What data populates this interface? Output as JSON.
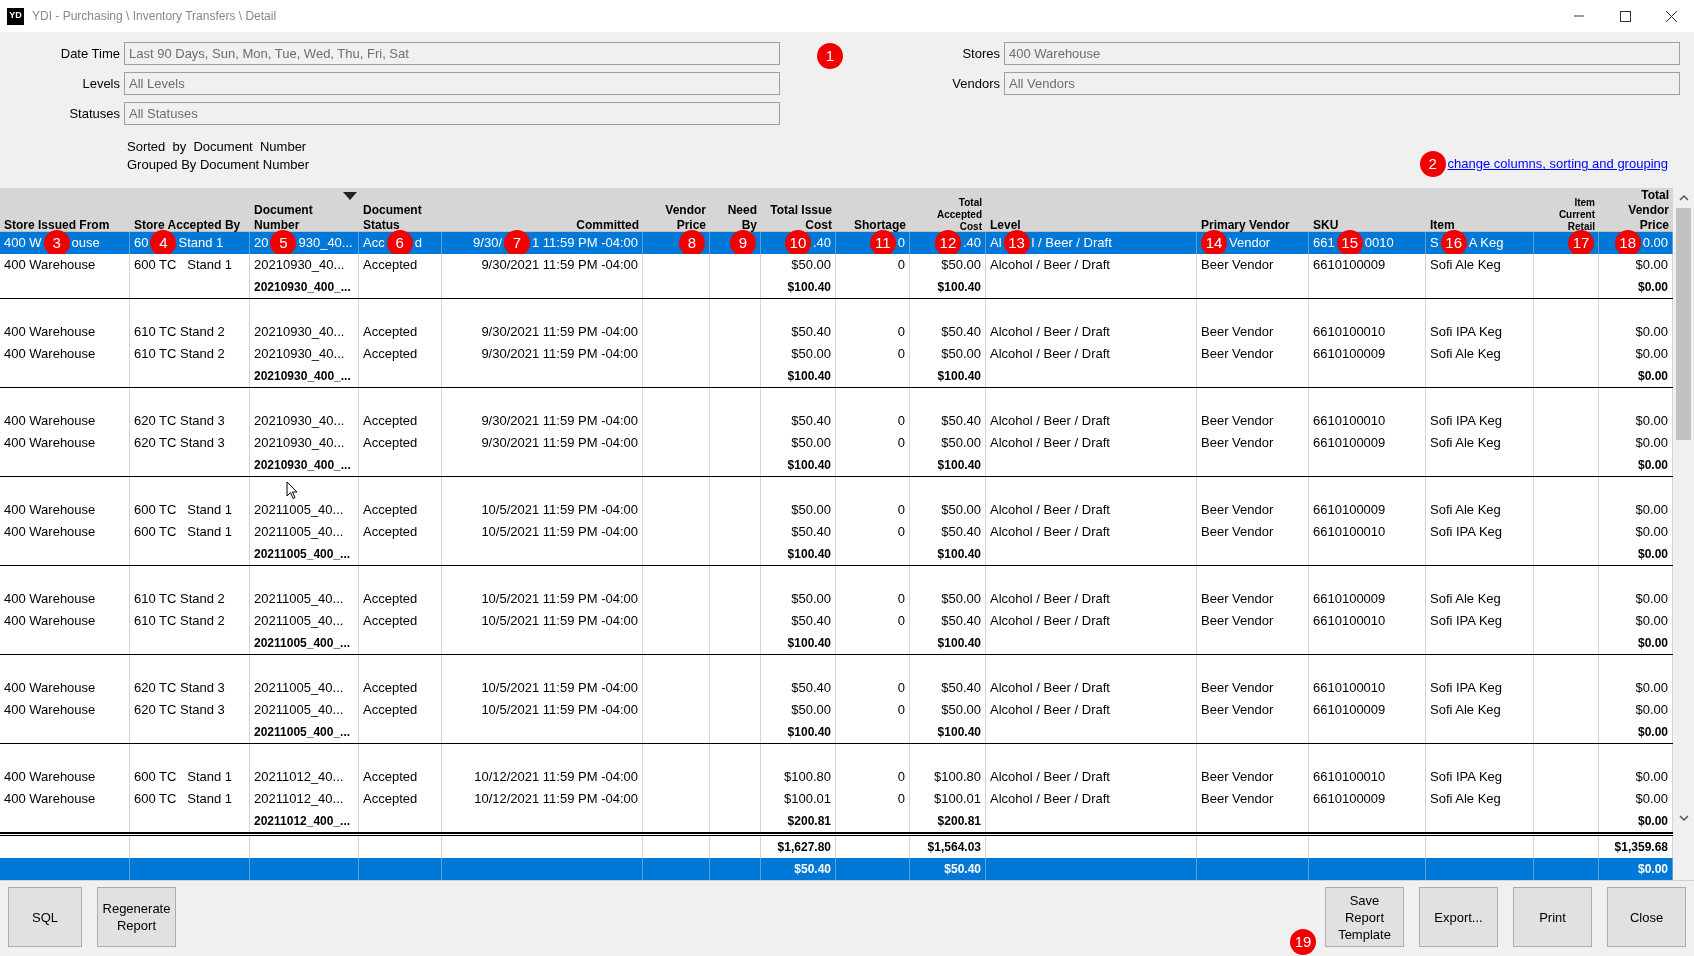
{
  "window": {
    "logo": "YD",
    "title": "YDI - Purchasing \\ Inventory Transfers \\ Detail"
  },
  "filters_left": [
    {
      "label": "Date Time",
      "value": "Last 90 Days, Sun, Mon, Tue, Wed, Thu, Fri, Sat"
    },
    {
      "label": "Levels",
      "value": "All Levels"
    },
    {
      "label": "Statuses",
      "value": "All Statuses"
    }
  ],
  "filters_right": [
    {
      "label": "Stores",
      "value": "400 Warehouse"
    },
    {
      "label": "Vendors",
      "value": "All Vendors"
    }
  ],
  "sort_info": [
    "Sorted  by  Document  Number",
    "Grouped By Document Number"
  ],
  "link": "change columns, sorting and grouping",
  "table": {
    "columns": [
      {
        "label": "Store Issued From",
        "sorted": false
      },
      {
        "label": "Store Accepted By",
        "sorted": false
      },
      {
        "label": "Document Number",
        "sorted": true
      },
      {
        "label": "Document Status",
        "sorted": false
      },
      {
        "label": "Committed",
        "sorted": false
      },
      {
        "label": "Vendor Price",
        "sorted": false
      },
      {
        "label": "Need By",
        "sorted": false
      },
      {
        "label": "Total Issue Cost",
        "sorted": false
      },
      {
        "label": "Shortage",
        "sorted": false
      },
      {
        "label": "Total Accepted Cost",
        "sorted": false
      },
      {
        "label": "Level",
        "sorted": false
      },
      {
        "label": "Primary Vendor",
        "sorted": false
      },
      {
        "label": "SKU",
        "sorted": false
      },
      {
        "label": "Item",
        "sorted": false
      },
      {
        "label": "Item Current Retail",
        "sorted": false
      },
      {
        "label": "Total Vendor Price",
        "sorted": false
      }
    ],
    "groups": [
      {
        "rows": [
          {
            "selected": true,
            "from": [
              "400 W",
              "ouse"
            ],
            "by": [
              "60",
              "Stand 1"
            ],
            "doc": [
              "20",
              "930_40..."
            ],
            "status": [
              "Acc",
              "d"
            ],
            "committed": [
              "9/30/",
              "1 11:59 PM -04:00"
            ],
            "issue": [
              ".40"
            ],
            "short": [
              "0"
            ],
            "acc": [
              ".40"
            ],
            "level": [
              "Al",
              "l / Beer / Draft"
            ],
            "vendor": [
              "Vendor"
            ],
            "sku": [
              "661",
              "0010"
            ],
            "item": [
              "S",
              "A Keg"
            ],
            "tvp": [
              "0.00"
            ]
          },
          {
            "selected": false,
            "from": "400 Warehouse",
            "by": "600 TC   Stand 1",
            "doc": "20210930_40...",
            "status": "Accepted",
            "committed": "9/30/2021 11:59 PM -04:00",
            "issue": "$50.00",
            "short": "0",
            "acc": "$50.00",
            "level": "Alcohol / Beer / Draft",
            "vendor": "Beer Vendor",
            "sku": "6610100009",
            "item": "Sofi Ale Keg",
            "tvp": "$0.00"
          }
        ],
        "subtotal": {
          "doc": "20210930_400_...",
          "issue": "$100.40",
          "acc": "$100.40",
          "tvp": "$0.00"
        }
      },
      {
        "rows": [
          {
            "selected": false,
            "from": "400 Warehouse",
            "by": "610 TC Stand 2",
            "doc": "20210930_40...",
            "status": "Accepted",
            "committed": "9/30/2021 11:59 PM -04:00",
            "issue": "$50.40",
            "short": "0",
            "acc": "$50.40",
            "level": "Alcohol / Beer / Draft",
            "vendor": "Beer Vendor",
            "sku": "6610100010",
            "item": "Sofi IPA Keg",
            "tvp": "$0.00"
          },
          {
            "selected": false,
            "from": "400 Warehouse",
            "by": "610 TC Stand 2",
            "doc": "20210930_40...",
            "status": "Accepted",
            "committed": "9/30/2021 11:59 PM -04:00",
            "issue": "$50.00",
            "short": "0",
            "acc": "$50.00",
            "level": "Alcohol / Beer / Draft",
            "vendor": "Beer Vendor",
            "sku": "6610100009",
            "item": "Sofi Ale Keg",
            "tvp": "$0.00"
          }
        ],
        "subtotal": {
          "doc": "20210930_400_...",
          "issue": "$100.40",
          "acc": "$100.40",
          "tvp": "$0.00"
        }
      },
      {
        "rows": [
          {
            "selected": false,
            "from": "400 Warehouse",
            "by": "620 TC Stand 3",
            "doc": "20210930_40...",
            "status": "Accepted",
            "committed": "9/30/2021 11:59 PM -04:00",
            "issue": "$50.40",
            "short": "0",
            "acc": "$50.40",
            "level": "Alcohol / Beer / Draft",
            "vendor": "Beer Vendor",
            "sku": "6610100010",
            "item": "Sofi IPA Keg",
            "tvp": "$0.00"
          },
          {
            "selected": false,
            "from": "400 Warehouse",
            "by": "620 TC Stand 3",
            "doc": "20210930_40...",
            "status": "Accepted",
            "committed": "9/30/2021 11:59 PM -04:00",
            "issue": "$50.00",
            "short": "0",
            "acc": "$50.00",
            "level": "Alcohol / Beer / Draft",
            "vendor": "Beer Vendor",
            "sku": "6610100009",
            "item": "Sofi Ale Keg",
            "tvp": "$0.00"
          }
        ],
        "subtotal": {
          "doc": "20210930_400_...",
          "issue": "$100.40",
          "acc": "$100.40",
          "tvp": "$0.00"
        }
      },
      {
        "rows": [
          {
            "selected": false,
            "from": "400 Warehouse",
            "by": "600 TC   Stand 1",
            "doc": "20211005_40...",
            "status": "Accepted",
            "committed": "10/5/2021 11:59 PM -04:00",
            "issue": "$50.00",
            "short": "0",
            "acc": "$50.00",
            "level": "Alcohol / Beer / Draft",
            "vendor": "Beer Vendor",
            "sku": "6610100009",
            "item": "Sofi Ale Keg",
            "tvp": "$0.00"
          },
          {
            "selected": false,
            "from": "400 Warehouse",
            "by": "600 TC   Stand 1",
            "doc": "20211005_40...",
            "status": "Accepted",
            "committed": "10/5/2021 11:59 PM -04:00",
            "issue": "$50.40",
            "short": "0",
            "acc": "$50.40",
            "level": "Alcohol / Beer / Draft",
            "vendor": "Beer Vendor",
            "sku": "6610100010",
            "item": "Sofi IPA Keg",
            "tvp": "$0.00"
          }
        ],
        "subtotal": {
          "doc": "20211005_400_...",
          "issue": "$100.40",
          "acc": "$100.40",
          "tvp": "$0.00"
        }
      },
      {
        "rows": [
          {
            "selected": false,
            "from": "400 Warehouse",
            "by": "610 TC Stand 2",
            "doc": "20211005_40...",
            "status": "Accepted",
            "committed": "10/5/2021 11:59 PM -04:00",
            "issue": "$50.00",
            "short": "0",
            "acc": "$50.00",
            "level": "Alcohol / Beer / Draft",
            "vendor": "Beer Vendor",
            "sku": "6610100009",
            "item": "Sofi Ale Keg",
            "tvp": "$0.00"
          },
          {
            "selected": false,
            "from": "400 Warehouse",
            "by": "610 TC Stand 2",
            "doc": "20211005_40...",
            "status": "Accepted",
            "committed": "10/5/2021 11:59 PM -04:00",
            "issue": "$50.40",
            "short": "0",
            "acc": "$50.40",
            "level": "Alcohol / Beer / Draft",
            "vendor": "Beer Vendor",
            "sku": "6610100010",
            "item": "Sofi IPA Keg",
            "tvp": "$0.00"
          }
        ],
        "subtotal": {
          "doc": "20211005_400_...",
          "issue": "$100.40",
          "acc": "$100.40",
          "tvp": "$0.00"
        }
      },
      {
        "rows": [
          {
            "selected": false,
            "from": "400 Warehouse",
            "by": "620 TC Stand 3",
            "doc": "20211005_40...",
            "status": "Accepted",
            "committed": "10/5/2021 11:59 PM -04:00",
            "issue": "$50.40",
            "short": "0",
            "acc": "$50.40",
            "level": "Alcohol / Beer / Draft",
            "vendor": "Beer Vendor",
            "sku": "6610100010",
            "item": "Sofi IPA Keg",
            "tvp": "$0.00"
          },
          {
            "selected": false,
            "from": "400 Warehouse",
            "by": "620 TC Stand 3",
            "doc": "20211005_40...",
            "status": "Accepted",
            "committed": "10/5/2021 11:59 PM -04:00",
            "issue": "$50.00",
            "short": "0",
            "acc": "$50.00",
            "level": "Alcohol / Beer / Draft",
            "vendor": "Beer Vendor",
            "sku": "6610100009",
            "item": "Sofi Ale Keg",
            "tvp": "$0.00"
          }
        ],
        "subtotal": {
          "doc": "20211005_400_...",
          "issue": "$100.40",
          "acc": "$100.40",
          "tvp": "$0.00"
        }
      },
      {
        "rows": [
          {
            "selected": false,
            "from": "400 Warehouse",
            "by": "600 TC   Stand 1",
            "doc": "20211012_40...",
            "status": "Accepted",
            "committed": "10/12/2021 11:59 PM -04:00",
            "issue": "$100.80",
            "short": "0",
            "acc": "$100.80",
            "level": "Alcohol / Beer / Draft",
            "vendor": "Beer Vendor",
            "sku": "6610100010",
            "item": "Sofi IPA Keg",
            "tvp": "$0.00"
          },
          {
            "selected": false,
            "from": "400 Warehouse",
            "by": "600 TC   Stand 1",
            "doc": "20211012_40...",
            "status": "Accepted",
            "committed": "10/12/2021 11:59 PM -04:00",
            "issue": "$100.01",
            "short": "0",
            "acc": "$100.01",
            "level": "Alcohol / Beer / Draft",
            "vendor": "Beer Vendor",
            "sku": "6610100009",
            "item": "Sofi Ale Keg",
            "tvp": "$0.00"
          }
        ],
        "subtotal": {
          "doc": "20211012_400_...",
          "issue": "$200.81",
          "acc": "$200.81",
          "tvp": "$0.00"
        }
      }
    ],
    "totals": [
      {
        "kind": "grand",
        "issue": "$1,627.80",
        "acc": "$1,564.03",
        "tvp": "$1,359.68"
      },
      {
        "kind": "selection",
        "issue": "$50.40",
        "acc": "$50.40",
        "tvp": "$0.00"
      }
    ]
  },
  "buttons_left": [
    "SQL",
    "Regenerate Report"
  ],
  "buttons_right": [
    "Save Report Template",
    "Export...",
    "Print",
    "Close"
  ],
  "annotations": [
    {
      "label": "1"
    },
    {
      "label": "2"
    },
    {
      "label": "3"
    },
    {
      "label": "4"
    },
    {
      "label": "5"
    },
    {
      "label": "6"
    },
    {
      "label": "7"
    },
    {
      "label": "8"
    },
    {
      "label": "9"
    },
    {
      "label": "10"
    },
    {
      "label": "11"
    },
    {
      "label": "12"
    },
    {
      "label": "13"
    },
    {
      "label": "14"
    },
    {
      "label": "15"
    },
    {
      "label": "16"
    },
    {
      "label": "17"
    },
    {
      "label": "18"
    },
    {
      "label": "19"
    }
  ]
}
